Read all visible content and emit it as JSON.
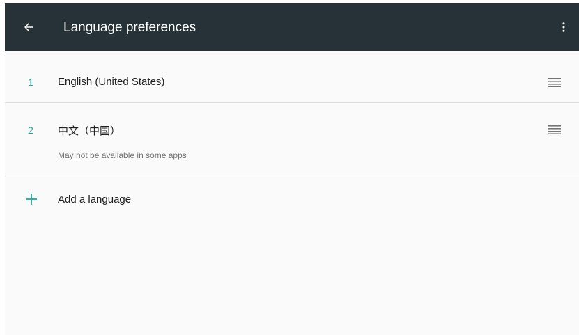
{
  "app_bar": {
    "title": "Language preferences",
    "back_icon": "arrow-back-icon",
    "menu_icon": "more-vert-icon",
    "background": "#263238"
  },
  "languages": [
    {
      "number": "1",
      "name": "English (United States)",
      "note": "",
      "handle_icon": "drag-handle-icon"
    },
    {
      "number": "2",
      "name": "中文（中国）",
      "note": "May not be available in some apps",
      "handle_icon": "drag-handle-icon"
    }
  ],
  "add_language": {
    "label": "Add a language",
    "icon": "add-icon"
  },
  "colors": {
    "accent": "#26a69a",
    "text_primary": "#212121",
    "text_secondary": "#757575"
  }
}
